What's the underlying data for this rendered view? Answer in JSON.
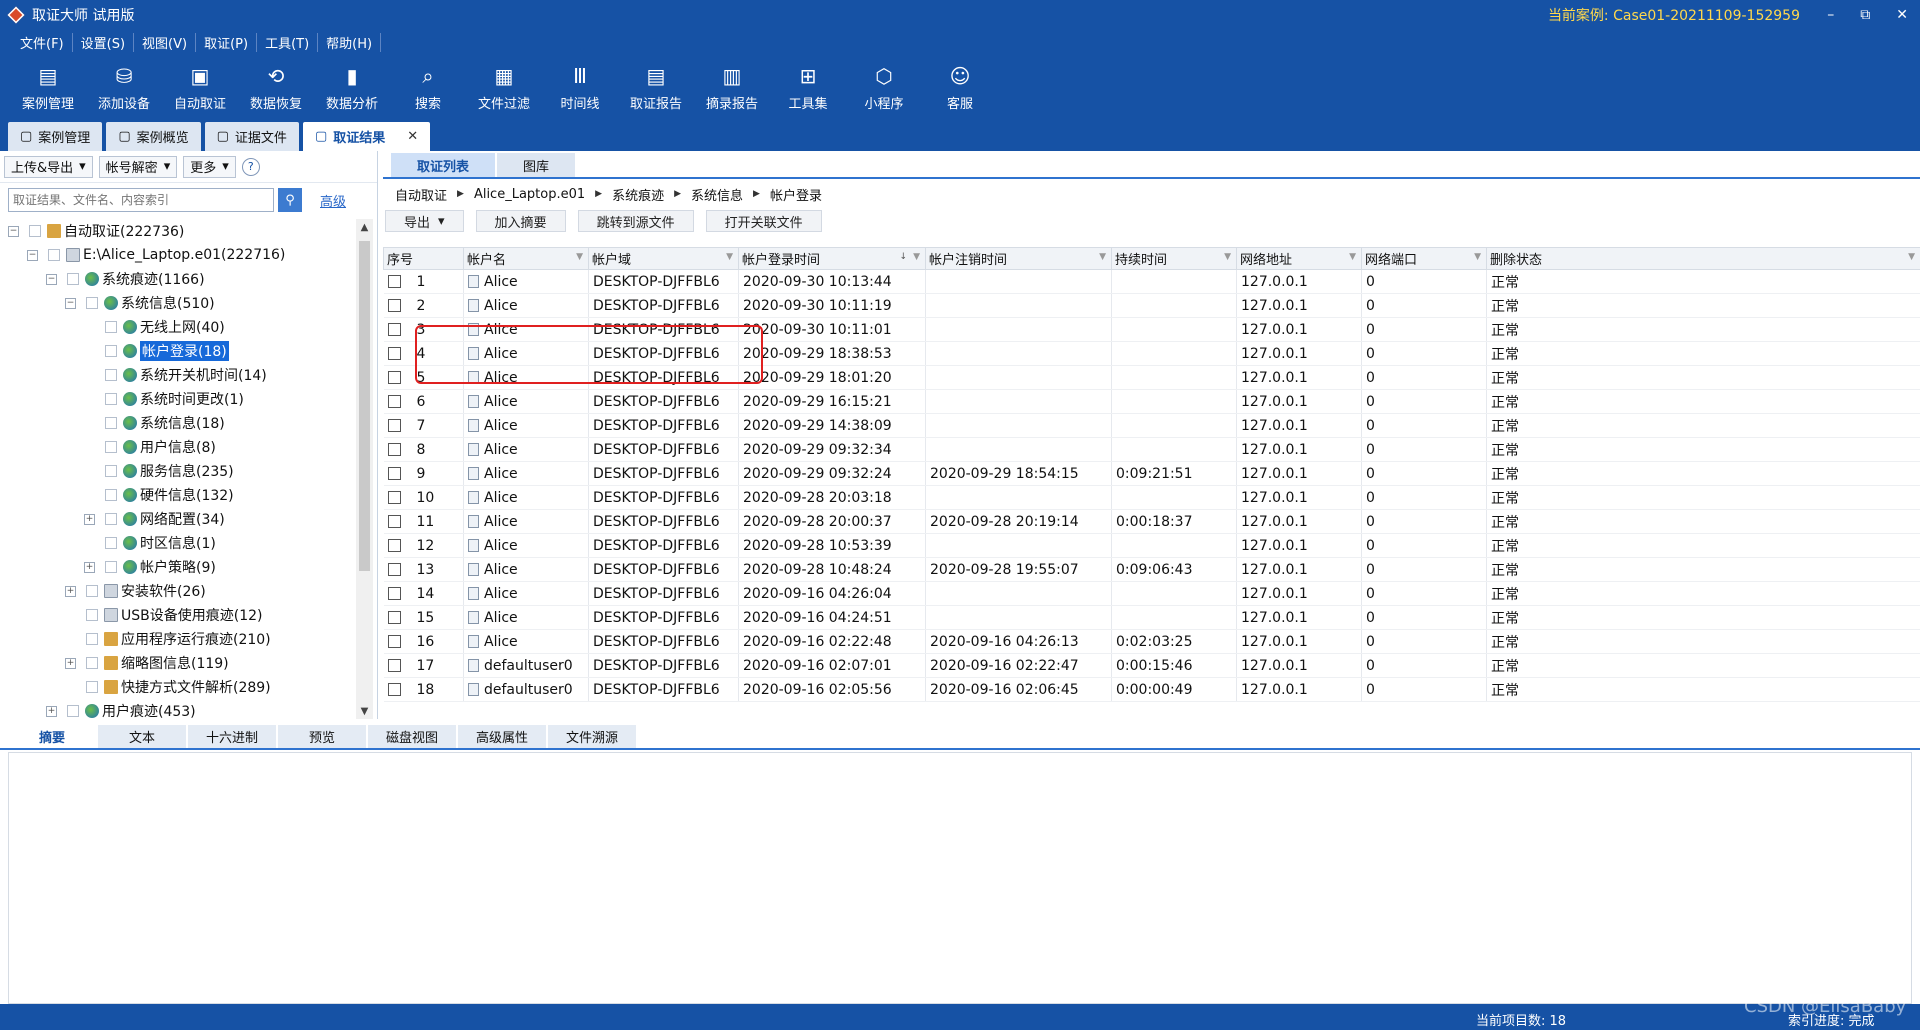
{
  "app": {
    "title": "取证大师 试用版",
    "current_case": "当前案例: Case01-20211109-152959",
    "win_buttons": [
      "–",
      "⧉",
      "✕"
    ]
  },
  "menu": [
    "文件(F)",
    "设置(S)",
    "视图(V)",
    "取证(P)",
    "工具(T)",
    "帮助(H)"
  ],
  "toolbar": [
    {
      "label": "案例管理",
      "icon": "case-icon"
    },
    {
      "label": "添加设备",
      "icon": "add-device-icon"
    },
    {
      "label": "自动取证",
      "icon": "auto-icon"
    },
    {
      "label": "数据恢复",
      "icon": "recover-icon"
    },
    {
      "label": "数据分析",
      "icon": "analysis-icon"
    },
    {
      "label": "搜索",
      "icon": "search-doc-icon"
    },
    {
      "label": "文件过滤",
      "icon": "filter-icon"
    },
    {
      "label": "时间线",
      "icon": "timeline-icon"
    },
    {
      "label": "取证报告",
      "icon": "report-icon"
    },
    {
      "label": "摘录报告",
      "icon": "excerpt-icon"
    },
    {
      "label": "工具集",
      "icon": "tools-icon"
    },
    {
      "label": "小程序",
      "icon": "miniapp-icon"
    },
    {
      "label": "客服",
      "icon": "support-icon"
    }
  ],
  "doc_tabs": [
    {
      "label": "案例管理",
      "active": false
    },
    {
      "label": "案例概览",
      "active": false
    },
    {
      "label": "证据文件",
      "active": false
    },
    {
      "label": "取证结果",
      "active": true
    }
  ],
  "left": {
    "upload_export": "上传&导出",
    "account_decrypt": "帐号解密",
    "more": "更多",
    "help": "?",
    "search_placeholder": "取证结果、文件名、内容索引",
    "advanced": "高级"
  },
  "tree": [
    {
      "label": "自动取证(222736)",
      "level": 0,
      "expander": "⊟",
      "icon": "folder"
    },
    {
      "label": "E:\\Alice_Laptop.e01(222716)",
      "level": 1,
      "expander": "⊟",
      "icon": "disk"
    },
    {
      "label": "系统痕迹(1166)",
      "level": 2,
      "expander": "⊟",
      "icon": "globe"
    },
    {
      "label": "系统信息(510)",
      "level": 3,
      "expander": "⊟",
      "icon": "globe"
    },
    {
      "label": "无线上网(40)",
      "level": 4,
      "expander": "",
      "icon": "globe"
    },
    {
      "label": "帐户登录(18)",
      "level": 4,
      "expander": "",
      "icon": "globe",
      "selected": true
    },
    {
      "label": "系统开关机时间(14)",
      "level": 4,
      "expander": "",
      "icon": "globe"
    },
    {
      "label": "系统时间更改(1)",
      "level": 4,
      "expander": "",
      "icon": "globe"
    },
    {
      "label": "系统信息(18)",
      "level": 4,
      "expander": "",
      "icon": "globe"
    },
    {
      "label": "用户信息(8)",
      "level": 4,
      "expander": "",
      "icon": "globe"
    },
    {
      "label": "服务信息(235)",
      "level": 4,
      "expander": "",
      "icon": "globe"
    },
    {
      "label": "硬件信息(132)",
      "level": 4,
      "expander": "",
      "icon": "globe"
    },
    {
      "label": "网络配置(34)",
      "level": 4,
      "expander": "⊞",
      "icon": "globe"
    },
    {
      "label": "时区信息(1)",
      "level": 4,
      "expander": "",
      "icon": "globe"
    },
    {
      "label": "帐户策略(9)",
      "level": 4,
      "expander": "⊞",
      "icon": "globe"
    },
    {
      "label": "安装软件(26)",
      "level": 3,
      "expander": "⊞",
      "icon": "disk"
    },
    {
      "label": "USB设备使用痕迹(12)",
      "level": 3,
      "expander": "",
      "icon": "disk"
    },
    {
      "label": "应用程序运行痕迹(210)",
      "level": 3,
      "expander": "",
      "icon": "folder"
    },
    {
      "label": "缩略图信息(119)",
      "level": 3,
      "expander": "⊞",
      "icon": "folder"
    },
    {
      "label": "快捷方式文件解析(289)",
      "level": 3,
      "expander": "",
      "icon": "folder"
    },
    {
      "label": "用户痕迹(453)",
      "level": 2,
      "expander": "⊞",
      "icon": "globe"
    }
  ],
  "sub_tabs": [
    {
      "label": "取证列表",
      "active": true
    },
    {
      "label": "图库",
      "active": false
    }
  ],
  "breadcrumb": [
    "自动取证",
    "Alice_Laptop.e01",
    "系统痕迹",
    "系统信息",
    "帐户登录"
  ],
  "actions": [
    "导出",
    "加入摘要",
    "跳转到源文件",
    "打开关联文件"
  ],
  "columns": [
    "序号",
    "帐户名",
    "帐户域",
    "帐户登录时间",
    "帐户注销时间",
    "持续时间",
    "网络地址",
    "网络端口",
    "删除状态"
  ],
  "rows": [
    [
      "1",
      "Alice",
      "DESKTOP-DJFFBL6",
      "2020-09-30 10:13:44",
      "",
      "",
      "127.0.0.1",
      "0",
      "正常"
    ],
    [
      "2",
      "Alice",
      "DESKTOP-DJFFBL6",
      "2020-09-30 10:11:19",
      "",
      "",
      "127.0.0.1",
      "0",
      "正常"
    ],
    [
      "3",
      "Alice",
      "DESKTOP-DJFFBL6",
      "2020-09-30 10:11:01",
      "",
      "",
      "127.0.0.1",
      "0",
      "正常"
    ],
    [
      "4",
      "Alice",
      "DESKTOP-DJFFBL6",
      "2020-09-29 18:38:53",
      "",
      "",
      "127.0.0.1",
      "0",
      "正常"
    ],
    [
      "5",
      "Alice",
      "DESKTOP-DJFFBL6",
      "2020-09-29 18:01:20",
      "",
      "",
      "127.0.0.1",
      "0",
      "正常"
    ],
    [
      "6",
      "Alice",
      "DESKTOP-DJFFBL6",
      "2020-09-29 16:15:21",
      "",
      "",
      "127.0.0.1",
      "0",
      "正常"
    ],
    [
      "7",
      "Alice",
      "DESKTOP-DJFFBL6",
      "2020-09-29 14:38:09",
      "",
      "",
      "127.0.0.1",
      "0",
      "正常"
    ],
    [
      "8",
      "Alice",
      "DESKTOP-DJFFBL6",
      "2020-09-29 09:32:34",
      "",
      "",
      "127.0.0.1",
      "0",
      "正常"
    ],
    [
      "9",
      "Alice",
      "DESKTOP-DJFFBL6",
      "2020-09-29 09:32:24",
      "2020-09-29 18:54:15",
      "0:09:21:51",
      "127.0.0.1",
      "0",
      "正常"
    ],
    [
      "10",
      "Alice",
      "DESKTOP-DJFFBL6",
      "2020-09-28 20:03:18",
      "",
      "",
      "127.0.0.1",
      "0",
      "正常"
    ],
    [
      "11",
      "Alice",
      "DESKTOP-DJFFBL6",
      "2020-09-28 20:00:37",
      "2020-09-28 20:19:14",
      "0:00:18:37",
      "127.0.0.1",
      "0",
      "正常"
    ],
    [
      "12",
      "Alice",
      "DESKTOP-DJFFBL6",
      "2020-09-28 10:53:39",
      "",
      "",
      "127.0.0.1",
      "0",
      "正常"
    ],
    [
      "13",
      "Alice",
      "DESKTOP-DJFFBL6",
      "2020-09-28 10:48:24",
      "2020-09-28 19:55:07",
      "0:09:06:43",
      "127.0.0.1",
      "0",
      "正常"
    ],
    [
      "14",
      "Alice",
      "DESKTOP-DJFFBL6",
      "2020-09-16 04:26:04",
      "",
      "",
      "127.0.0.1",
      "0",
      "正常"
    ],
    [
      "15",
      "Alice",
      "DESKTOP-DJFFBL6",
      "2020-09-16 04:24:51",
      "",
      "",
      "127.0.0.1",
      "0",
      "正常"
    ],
    [
      "16",
      "Alice",
      "DESKTOP-DJFFBL6",
      "2020-09-16 02:22:48",
      "2020-09-16 04:26:13",
      "0:02:03:25",
      "127.0.0.1",
      "0",
      "正常"
    ],
    [
      "17",
      "defaultuser0",
      "DESKTOP-DJFFBL6",
      "2020-09-16 02:07:01",
      "2020-09-16 02:22:47",
      "0:00:15:46",
      "127.0.0.1",
      "0",
      "正常"
    ],
    [
      "18",
      "defaultuser0",
      "DESKTOP-DJFFBL6",
      "2020-09-16 02:05:56",
      "2020-09-16 02:06:45",
      "0:00:00:49",
      "127.0.0.1",
      "0",
      "正常"
    ]
  ],
  "bottom_tabs": [
    {
      "label": "摘要",
      "active": true
    },
    {
      "label": "文本",
      "active": false
    },
    {
      "label": "十六进制",
      "active": false
    },
    {
      "label": "预览",
      "active": false
    },
    {
      "label": "磁盘视图",
      "active": false
    },
    {
      "label": "高级属性",
      "active": false
    },
    {
      "label": "文件溯源",
      "active": false
    }
  ],
  "status": {
    "count": "当前项目数: 18",
    "index": "索引进度: 完成",
    "watermark": "CSDN @EllsaBaby"
  },
  "colors": {
    "brand": "#1652a5",
    "highlight": "#e02020",
    "selection": "#1669d9"
  }
}
